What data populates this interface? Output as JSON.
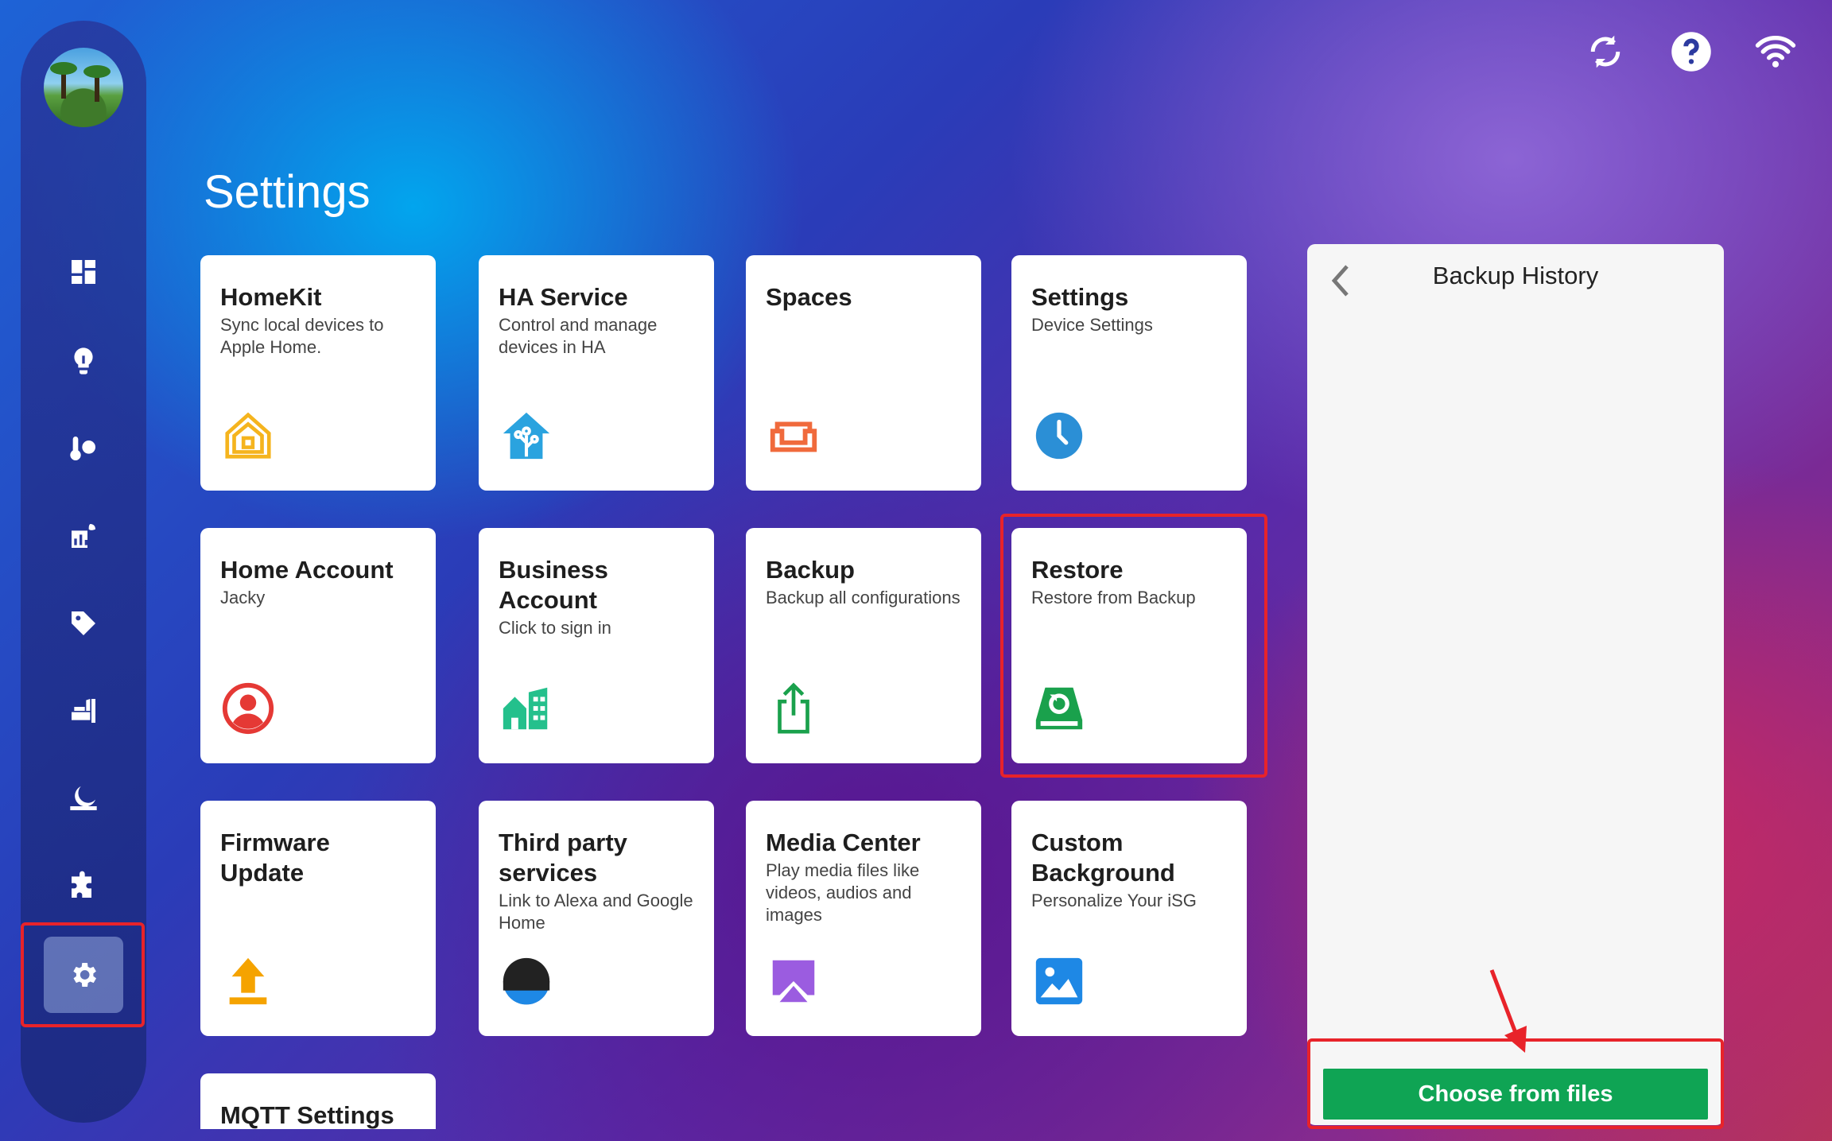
{
  "page": {
    "title": "Settings"
  },
  "sidebar": {
    "items": [
      {
        "name": "dashboard",
        "icon": "dashboard-icon"
      },
      {
        "name": "lights",
        "icon": "lightbulb-icon"
      },
      {
        "name": "climate",
        "icon": "thermometer-icon"
      },
      {
        "name": "energy",
        "icon": "energy-icon"
      },
      {
        "name": "tags",
        "icon": "tag-icon"
      },
      {
        "name": "rooms",
        "icon": "room-icon"
      },
      {
        "name": "scenes",
        "icon": "moon-icon"
      },
      {
        "name": "plugins",
        "icon": "puzzle-icon"
      },
      {
        "name": "settings",
        "icon": "gear-icon",
        "active": true
      }
    ]
  },
  "cards": [
    {
      "title": "HomeKit",
      "desc": "Sync local devices to Apple Home.",
      "icon": "homekit-icon"
    },
    {
      "title": "HA Service",
      "desc": "Control and manage devices in HA",
      "icon": "ha-house-icon"
    },
    {
      "title": "Spaces",
      "desc": "",
      "icon": "sofa-icon"
    },
    {
      "title": "Settings",
      "desc": "Device Settings",
      "icon": "clock-icon"
    },
    {
      "title": "Home Account",
      "desc": "Jacky",
      "icon": "user-circle-icon"
    },
    {
      "title": "Business Account",
      "desc": "Click to sign in",
      "icon": "building-icon"
    },
    {
      "title": "Backup",
      "desc": "Backup all configurations",
      "icon": "share-upload-icon"
    },
    {
      "title": "Restore",
      "desc": "Restore from Backup",
      "icon": "restore-drive-icon"
    },
    {
      "title": "Firmware Update",
      "desc": "",
      "icon": "upload-arrow-icon"
    },
    {
      "title": "Third party services",
      "desc": "Link to Alexa and Google Home",
      "icon": "echo-speaker-icon"
    },
    {
      "title": "Media Center",
      "desc": "Play media files like videos, audios and images",
      "icon": "airplay-icon"
    },
    {
      "title": "Custom Background",
      "desc": "Personalize Your iSG",
      "icon": "image-icon"
    },
    {
      "title": "MQTT Settings",
      "desc": "",
      "icon": ""
    }
  ],
  "panel": {
    "title": "Backup History",
    "button_label": "Choose from files"
  },
  "colors": {
    "button_green": "#0fa454",
    "highlight_red": "#e8232a",
    "homekit_yellow": "#f5b41e",
    "ha_blue": "#2aa3df",
    "spaces_orange": "#f06a3c",
    "clock_blue": "#2b8fd6",
    "user_red": "#e53935",
    "building_green": "#24c08c",
    "backup_green": "#1aa14c",
    "firmware_orange": "#f5a300",
    "media_purple": "#9b5ce0",
    "image_blue": "#1e88e5"
  }
}
